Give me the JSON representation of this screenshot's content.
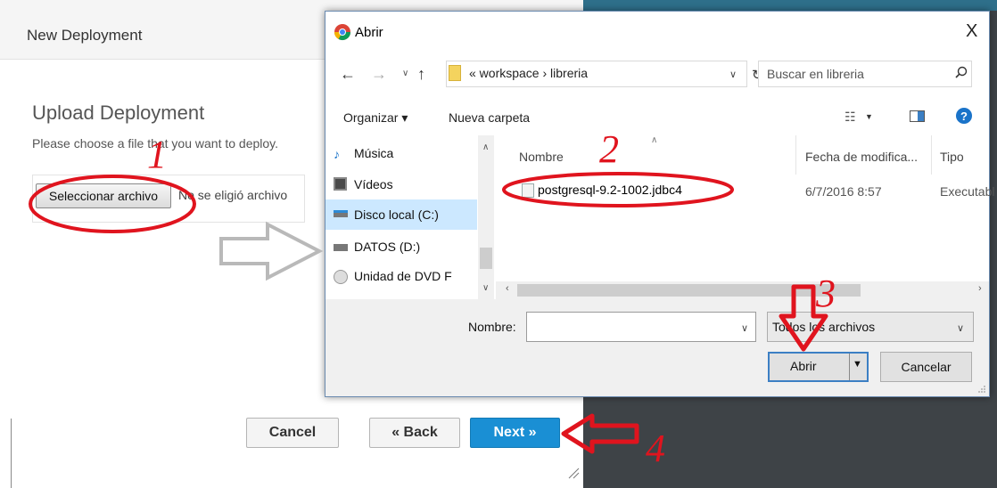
{
  "wizard": {
    "title": "New Deployment",
    "heading": "Upload Deployment",
    "description": "Please choose a file that you want to deploy.",
    "file_button": "Seleccionar archivo",
    "file_status": "No se eligió archivo",
    "cancel": "Cancel",
    "back": "« Back",
    "next": "Next »"
  },
  "dialog": {
    "title": "Abrir",
    "close": "X",
    "breadcrumb": "«  workspace  ›  libreria",
    "search_placeholder": "Buscar en libreria",
    "toolbar": {
      "organize": "Organizar ▾",
      "new_folder": "Nueva carpeta"
    },
    "sidebar": [
      {
        "label": "Música",
        "icon": "music-icon"
      },
      {
        "label": "Vídeos",
        "icon": "video-icon"
      },
      {
        "label": "Disco local (C:)",
        "icon": "drive-c-icon"
      },
      {
        "label": "DATOS (D:)",
        "icon": "drive-d-icon"
      },
      {
        "label": "Unidad de DVD F",
        "icon": "dvd-icon"
      }
    ],
    "columns": {
      "name": "Nombre",
      "date": "Fecha de modifica...",
      "type": "Tipo"
    },
    "files": [
      {
        "name": "postgresql-9.2-1002.jdbc4",
        "date": "6/7/2016 8:57",
        "type": "Executabl"
      }
    ],
    "filename_label": "Nombre:",
    "filename_value": "",
    "filter": "Todos los archivos",
    "open": "Abrir",
    "cancel": "Cancelar"
  },
  "annotations": {
    "step1": "1",
    "step2": "2",
    "step3": "3",
    "step4": "4",
    "color": "#e0141e"
  },
  "colors": {
    "next_button": "#1a8fd4",
    "selection": "#cce8ff",
    "backdrop": "#3e4347"
  }
}
